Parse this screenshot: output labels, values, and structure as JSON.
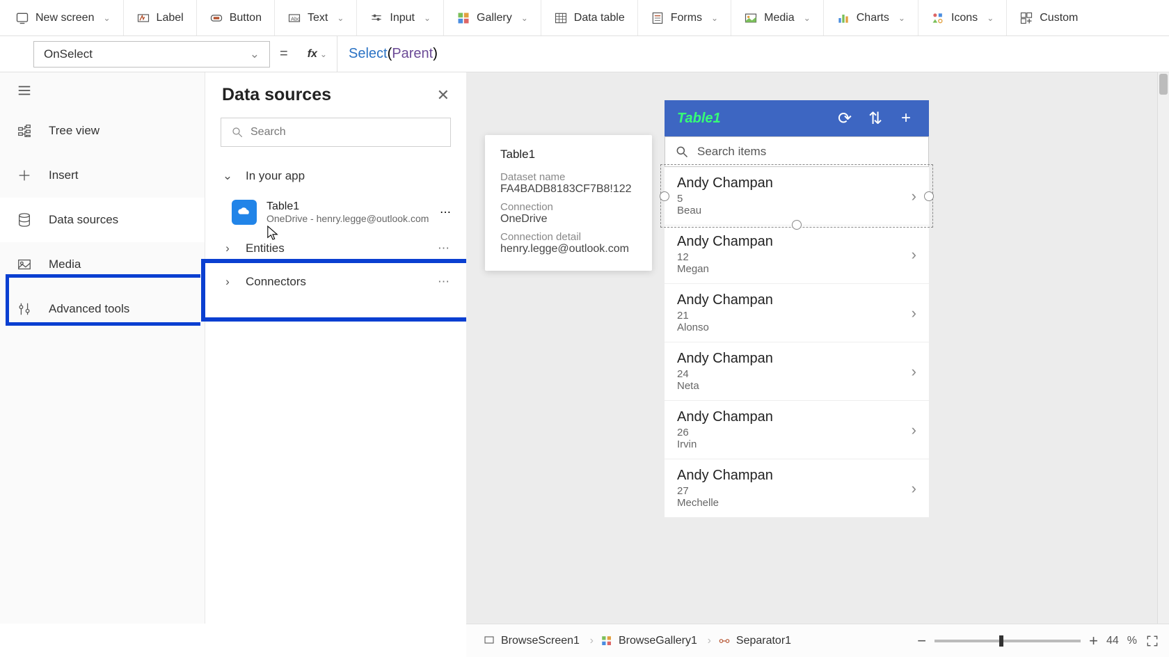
{
  "toolbar": {
    "newScreen": "New screen",
    "label": "Label",
    "button": "Button",
    "text": "Text",
    "input": "Input",
    "gallery": "Gallery",
    "dataTable": "Data table",
    "forms": "Forms",
    "media": "Media",
    "charts": "Charts",
    "icons": "Icons",
    "custom": "Custom"
  },
  "formulaBar": {
    "property": "OnSelect",
    "functionName": "Select",
    "openParen": "(",
    "argument": "Parent",
    "closeParen": ")"
  },
  "rail": {
    "treeView": "Tree view",
    "insert": "Insert",
    "dataSources": "Data sources",
    "media": "Media",
    "advancedTools": "Advanced tools"
  },
  "panel": {
    "title": "Data sources",
    "searchPlaceholder": "Search",
    "sections": {
      "inYourApp": "In your app",
      "entities": "Entities",
      "connectors": "Connectors"
    },
    "dataSource": {
      "name": "Table1",
      "subtitle": "OneDrive - henry.legge@outlook.com"
    }
  },
  "tooltip": {
    "title": "Table1",
    "datasetNameLabel": "Dataset name",
    "datasetNameValue": "FA4BADB8183CF7B8!122",
    "connectionLabel": "Connection",
    "connectionValue": "OneDrive",
    "connectionDetailLabel": "Connection detail",
    "connectionDetailValue": "henry.legge@outlook.com"
  },
  "canvas": {
    "headerTitle": "Table1",
    "searchPlaceholder": "Search items",
    "items": [
      {
        "name": "Andy Champan",
        "count": "5",
        "sub": "Beau"
      },
      {
        "name": "Andy Champan",
        "count": "12",
        "sub": "Megan"
      },
      {
        "name": "Andy Champan",
        "count": "21",
        "sub": "Alonso"
      },
      {
        "name": "Andy Champan",
        "count": "24",
        "sub": "Neta"
      },
      {
        "name": "Andy Champan",
        "count": "26",
        "sub": "Irvin"
      },
      {
        "name": "Andy Champan",
        "count": "27",
        "sub": "Mechelle"
      }
    ]
  },
  "breadcrumb": {
    "items": [
      "BrowseScreen1",
      "BrowseGallery1",
      "Separator1"
    ],
    "zoomValue": "44",
    "zoomPercent": "%"
  }
}
